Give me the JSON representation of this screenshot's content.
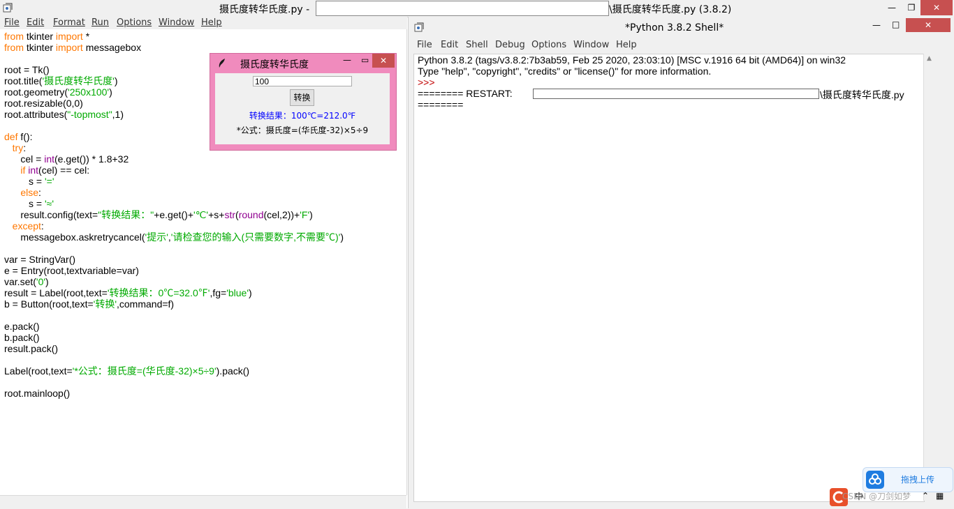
{
  "editor": {
    "title_left": "摄氏度转华氏度.py - ",
    "title_right": "\\摄氏度转华氏度.py (3.8.2)",
    "menu": [
      "File",
      "Edit",
      "Format",
      "Run",
      "Options",
      "Window",
      "Help"
    ],
    "code": [
      [
        [
          "kw",
          "from"
        ],
        [
          "t",
          " tkinter "
        ],
        [
          "kw",
          "import"
        ],
        [
          "t",
          " *"
        ]
      ],
      [
        [
          "kw",
          "from"
        ],
        [
          "t",
          " tkinter "
        ],
        [
          "kw",
          "import"
        ],
        [
          "t",
          " messagebox"
        ]
      ],
      [],
      [
        [
          "t",
          "root = Tk()"
        ]
      ],
      [
        [
          "t",
          "root.title("
        ],
        [
          "st",
          "'摄氏度转华氏度'"
        ],
        [
          "t",
          ")"
        ]
      ],
      [
        [
          "t",
          "root.geometry("
        ],
        [
          "st",
          "'250x100'"
        ],
        [
          "t",
          ")"
        ]
      ],
      [
        [
          "t",
          "root.resizable(0,0)"
        ]
      ],
      [
        [
          "t",
          "root.attributes("
        ],
        [
          "st",
          "\"-topmost\""
        ],
        [
          "t",
          ",1)"
        ]
      ],
      [],
      [
        [
          "kw",
          "def"
        ],
        [
          "t",
          " f():"
        ]
      ],
      [
        [
          "t",
          "   "
        ],
        [
          "kw",
          "try"
        ],
        [
          "t",
          ":"
        ]
      ],
      [
        [
          "t",
          "      cel = "
        ],
        [
          "bi",
          "int"
        ],
        [
          "t",
          "(e.get()) * 1.8+32"
        ]
      ],
      [
        [
          "t",
          "      "
        ],
        [
          "kw",
          "if"
        ],
        [
          "t",
          " "
        ],
        [
          "bi",
          "int"
        ],
        [
          "t",
          "(cel) == cel:"
        ]
      ],
      [
        [
          "t",
          "         s = "
        ],
        [
          "st",
          "'='"
        ]
      ],
      [
        [
          "t",
          "      "
        ],
        [
          "kw",
          "else"
        ],
        [
          "t",
          ":"
        ]
      ],
      [
        [
          "t",
          "         s = "
        ],
        [
          "st",
          "'≈'"
        ]
      ],
      [
        [
          "t",
          "      result.config(text="
        ],
        [
          "st",
          "\"转换结果：\""
        ],
        [
          "t",
          "+e.get()+"
        ],
        [
          "st",
          "'℃'"
        ],
        [
          "t",
          "+s+"
        ],
        [
          "bi",
          "str"
        ],
        [
          "t",
          "("
        ],
        [
          "bi",
          "round"
        ],
        [
          "t",
          "(cel,2))+"
        ],
        [
          "st",
          "'F'"
        ],
        [
          "t",
          ")"
        ]
      ],
      [
        [
          "t",
          "   "
        ],
        [
          "kw",
          "except"
        ],
        [
          "t",
          ":"
        ]
      ],
      [
        [
          "t",
          "      messagebox.askretrycancel("
        ],
        [
          "st",
          "'提示'"
        ],
        [
          "t",
          ","
        ],
        [
          "st",
          "'请检查您的输入(只需要数字,不需要℃)'"
        ],
        [
          "t",
          ")"
        ]
      ],
      [],
      [
        [
          "t",
          "var = StringVar()"
        ]
      ],
      [
        [
          "t",
          "e = Entry(root,textvariable=var)"
        ]
      ],
      [
        [
          "t",
          "var.set("
        ],
        [
          "st",
          "'0'"
        ],
        [
          "t",
          ")"
        ]
      ],
      [
        [
          "t",
          "result = Label(root,text="
        ],
        [
          "st",
          "'转换结果：0℃=32.0℉'"
        ],
        [
          "t",
          ",fg="
        ],
        [
          "st",
          "'blue'"
        ],
        [
          "t",
          ")"
        ]
      ],
      [
        [
          "t",
          "b = Button(root,text="
        ],
        [
          "st",
          "'转换'"
        ],
        [
          "t",
          ",command=f)"
        ]
      ],
      [],
      [
        [
          "t",
          "e.pack()"
        ]
      ],
      [
        [
          "t",
          "b.pack()"
        ]
      ],
      [
        [
          "t",
          "result.pack()"
        ]
      ],
      [],
      [
        [
          "t",
          "Label(root,text="
        ],
        [
          "st",
          "'*公式：摄氏度=(华氏度-32)×5÷9'"
        ],
        [
          "t",
          ").pack()"
        ]
      ],
      [],
      [
        [
          "t",
          "root.mainloop()"
        ]
      ]
    ]
  },
  "tkapp": {
    "title": "摄氏度转华氏度",
    "entry_value": "100",
    "button_label": "转换",
    "result_text": "转换结果：100℃=212.0℉",
    "formula_text": "*公式：摄氏度=(华氏度-32)×5÷9"
  },
  "shell": {
    "title": "*Python 3.8.2 Shell*",
    "menu": [
      "File",
      "Edit",
      "Shell",
      "Debug",
      "Options",
      "Window",
      "Help"
    ],
    "line1": "Python 3.8.2 (tags/v3.8.2:7b3ab59, Feb 25 2020, 23:03:10) [MSC v.1916 64 bit (AMD64)] on win32",
    "line2": "Type \"help\", \"copyright\", \"credits\" or \"license()\" for more information.",
    "prompt": ">>>",
    "restart_prefix": "======== RESTART: ",
    "restart_suffix": "\\摄氏度转华氏度.py",
    "restart_tail": "========"
  },
  "overlay": {
    "upload_label": "拖拽上传",
    "watermark": "CSDN @刀剑如梦",
    "ime_label": "中"
  },
  "colors": {
    "keyword": "#ff7700",
    "builtin": "#900090",
    "string": "#00aa00",
    "tk_title_bg": "#f08bbd",
    "close_red": "#c75050"
  }
}
